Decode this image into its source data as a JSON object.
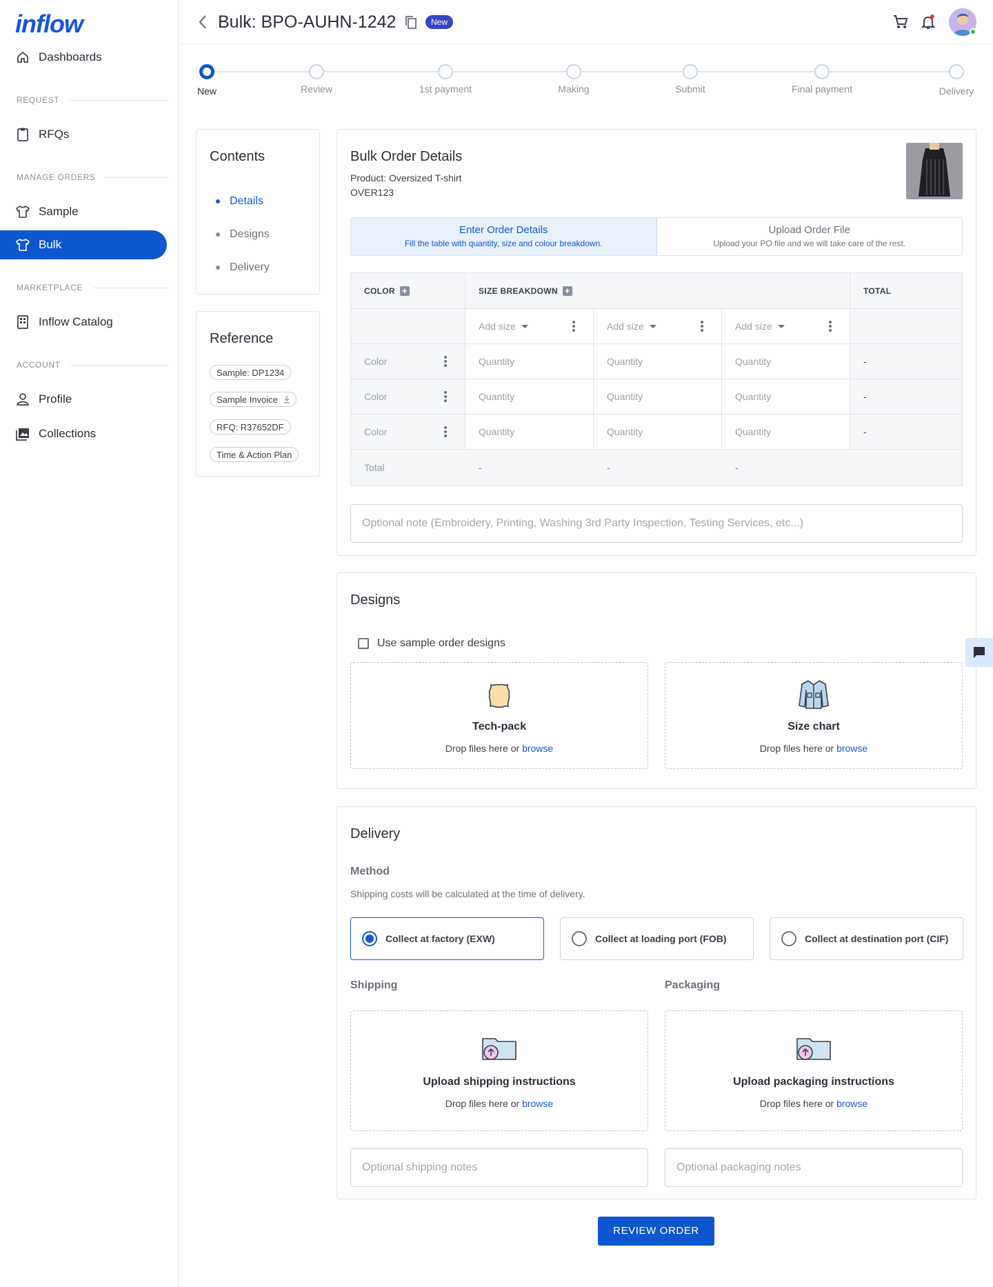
{
  "brand": {
    "logo_text": "inflow",
    "accent": "#0f57d1"
  },
  "sidebar": {
    "items": [
      {
        "label": "Dashboards",
        "icon": "home-icon"
      },
      {
        "label": "RFQs",
        "icon": "clipboard-icon"
      },
      {
        "label": "Sample",
        "icon": "tshirt-icon"
      },
      {
        "label": "Bulk",
        "icon": "tshirt-icon",
        "active": true
      },
      {
        "label": "Inflow Catalog",
        "icon": "catalog-icon"
      },
      {
        "label": "Profile",
        "icon": "person-icon"
      },
      {
        "label": "Collections",
        "icon": "gallery-icon"
      }
    ],
    "sections": [
      "REQUEST",
      "MANAGE ORDERS",
      "MARKETPLACE",
      "ACCOUNT"
    ]
  },
  "header": {
    "title": "Bulk: BPO-AUHN-1242",
    "badge": "New"
  },
  "stepper": {
    "steps": [
      "New",
      "Review",
      "1st payment",
      "Making",
      "Submit",
      "Final payment",
      "Delivery"
    ],
    "current_index": 0
  },
  "contents": {
    "title": "Contents",
    "items": [
      "Details",
      "Designs",
      "Delivery"
    ]
  },
  "reference": {
    "title": "Reference",
    "chips": [
      "Sample: DP1234",
      "Sample Invoice",
      "RFQ: R37652DF",
      "Time & Action Plan"
    ]
  },
  "order": {
    "title": "Bulk Order Details",
    "product_line": "Product: Oversized T-shirt",
    "product_code": "OVER123",
    "tab_enter": {
      "title": "Enter Order Details",
      "subtitle": "Fill the table with quantity, size and colour breakdown."
    },
    "tab_upload": {
      "title": "Upload Order File",
      "subtitle": "Upload your PO file and we will take care of the rest."
    },
    "table": {
      "col_color": "COLOR",
      "col_size": "SIZE BREAKDOWN",
      "col_total": "TOTAL",
      "add_size": "Add size",
      "color_placeholder": "Color",
      "qty_placeholder": "Quantity",
      "dash": "-",
      "total_label": "Total"
    },
    "note_placeholder": "Optional note (Embroidery, Printing, Washing 3rd Party Inspection, Testing Services, etc...)"
  },
  "designs": {
    "title": "Designs",
    "checkbox_label": "Use sample order designs",
    "drop_sub": "Drop files here or",
    "browse": "browse",
    "zones": [
      {
        "title": "Tech-pack",
        "icon": "leather-icon"
      },
      {
        "title": "Size chart",
        "icon": "shirt-icon"
      }
    ]
  },
  "delivery": {
    "title": "Delivery",
    "method_label": "Method",
    "method_note": "Shipping costs will be calculated at the time of delivery.",
    "methods": [
      {
        "label": "Collect at factory (EXW)",
        "selected": true
      },
      {
        "label": "Collect at loading port (FOB)",
        "selected": false
      },
      {
        "label": "Collect at destination port (CIF)",
        "selected": false
      }
    ],
    "shipping_label": "Shipping",
    "packaging_label": "Packaging",
    "shipping_zone_title": "Upload shipping instructions",
    "packaging_zone_title": "Upload packaging instructions",
    "shipping_notes_placeholder": "Optional shipping notes",
    "packaging_notes_placeholder": "Optional packaging notes"
  },
  "review_button": "REVIEW ORDER"
}
